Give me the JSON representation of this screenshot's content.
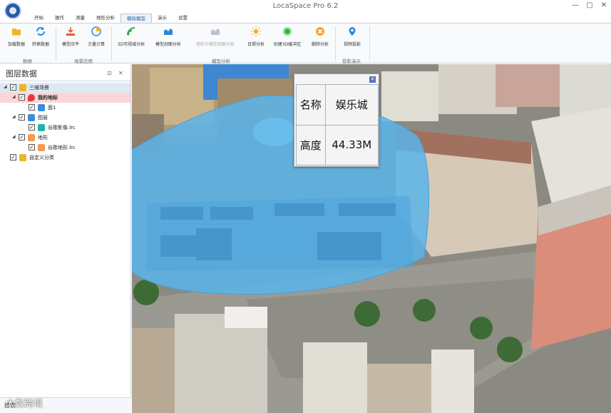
{
  "window": {
    "title": "LocaSpace Pro 6.2",
    "minimize": "—",
    "maximize": "▢",
    "close": "✕"
  },
  "tabs": [
    "开始",
    "操作",
    "测量",
    "地形分析",
    "模拟模型",
    "演示",
    "设置"
  ],
  "ribbon": {
    "buttons": [
      {
        "label": "加载数据",
        "icon": "folder-icon"
      },
      {
        "label": "转换数据",
        "icon": "refresh-icon"
      },
      {
        "label": "模型压平",
        "icon": "flatten-icon"
      },
      {
        "label": "方量计算",
        "icon": "pie-icon"
      },
      {
        "label": "3D可视域分析",
        "icon": "viewshed-icon"
      },
      {
        "label": "模型剖面分析",
        "icon": "profile-icon"
      },
      {
        "label": "地形与模型剖面分析",
        "icon": "terrain-profile-icon",
        "disabled": true
      },
      {
        "label": "日照分析",
        "icon": "sun-icon"
      },
      {
        "label": "创建3D缓冲区",
        "icon": "buffer-icon"
      },
      {
        "label": "删除分析",
        "icon": "delete-icon"
      },
      {
        "label": "视频投影",
        "icon": "video-icon"
      }
    ],
    "groups": [
      "数据",
      "场景应用",
      "模型分析",
      "投影演示"
    ]
  },
  "panel": {
    "title": "图层数据",
    "pin": "⊡",
    "close": "✕",
    "tree": [
      {
        "label": "三维场景",
        "level": 0,
        "icon": "folder-icon"
      },
      {
        "label": "我的地标",
        "level": 1,
        "icon": "pin-icon"
      },
      {
        "label": "面1",
        "level": 2,
        "icon": "polygon-icon"
      },
      {
        "label": "图层",
        "level": 1,
        "icon": "layers-icon"
      },
      {
        "label": "谷歌影像.lrc",
        "level": 2,
        "icon": "raster-icon"
      },
      {
        "label": "地形",
        "level": 1,
        "icon": "terrain-icon"
      },
      {
        "label": "谷歌地形.lrc",
        "level": 2,
        "icon": "terrain-icon"
      },
      {
        "label": "自定义分类",
        "level": 0,
        "icon": "folder-icon"
      }
    ],
    "bottom_label": "搜索"
  },
  "popup": {
    "rows": [
      {
        "key": "名称",
        "value": "娱乐城"
      },
      {
        "key": "高度",
        "value": "44.33M"
      }
    ],
    "close": "✕"
  },
  "watermark": "大数跨境",
  "colors": {
    "accent": "#1e5aa0",
    "highlight": "#5ab4ea",
    "selected_row": "#fbd6d6"
  }
}
